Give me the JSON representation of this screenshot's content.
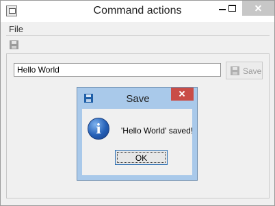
{
  "window": {
    "title": "Command actions"
  },
  "menubar": {
    "items": [
      {
        "label": "File"
      }
    ]
  },
  "toolbar": {
    "items": [
      {
        "icon": "floppy-disk-icon",
        "enabled": false
      }
    ]
  },
  "main": {
    "text_input_value": "Hello World",
    "save_button_label": "Save",
    "save_button_icon": "floppy-disk-icon",
    "save_button_enabled": false
  },
  "dialog": {
    "title": "Save",
    "title_icon": "floppy-disk-icon",
    "message_icon": "information-icon",
    "info_glyph": "i",
    "message": "'Hello World' saved!",
    "ok_label": "OK"
  },
  "colors": {
    "dialog_frame": "#a9c9ea",
    "dialog_close": "#c94d47",
    "window_bg": "#f0f0f0"
  }
}
